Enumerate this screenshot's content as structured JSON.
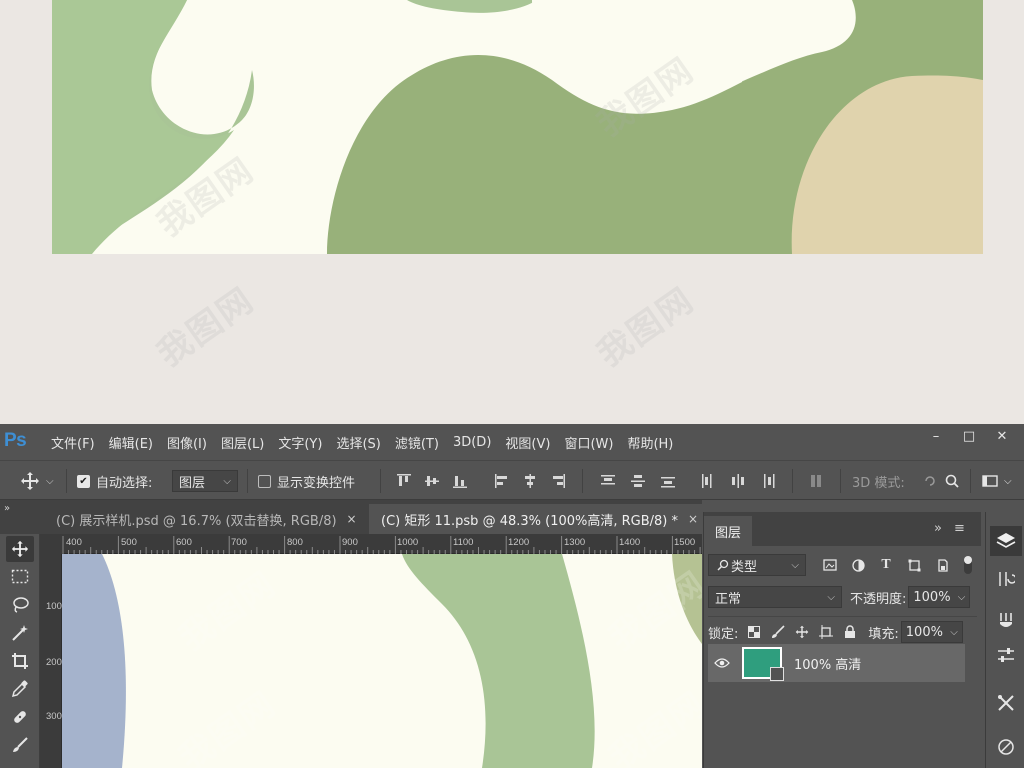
{
  "photoshop": {
    "logo": "Ps",
    "menu": [
      "文件(F)",
      "编辑(E)",
      "图像(I)",
      "图层(L)",
      "文字(Y)",
      "选择(S)",
      "滤镜(T)",
      "3D(D)",
      "视图(V)",
      "窗口(W)",
      "帮助(H)"
    ],
    "window_controls": [
      "–",
      "□",
      "✕"
    ]
  },
  "options_bar": {
    "auto_select_label": "自动选择:",
    "auto_select_checked": true,
    "auto_select_target": "图层",
    "show_transform_label": "显示变换控件",
    "show_transform_checked": false,
    "mode_3d_label": "3D 模式:"
  },
  "documents": {
    "tabs": [
      {
        "title": "(C) 展示样机.psd @ 16.7% (双击替换, RGB/8)",
        "close": "×",
        "active": false
      },
      {
        "title": "(C) 矩形 11.psb @ 48.3% (100%高清, RGB/8) *",
        "close": "×",
        "active": true
      }
    ]
  },
  "rulers": {
    "horizontal": [
      "400",
      "500",
      "600",
      "700",
      "800",
      "900",
      "1000",
      "1100",
      "1200",
      "1300",
      "1400",
      "1500"
    ],
    "vertical": [
      "100",
      "200",
      "300"
    ]
  },
  "layers_panel": {
    "title": "图层",
    "filter_kind": "类型",
    "blend_mode": "正常",
    "opacity_label": "不透明度:",
    "opacity_value": "100%",
    "lock_label": "锁定:",
    "fill_label": "填充:",
    "fill_value": "100%",
    "layers": [
      {
        "name": "100% 高清",
        "visible": true,
        "thumb_color": "#2f9e7e"
      }
    ]
  },
  "colors": {
    "artwork_cream": "#fcfcf1",
    "artwork_green": "#a9c596",
    "artwork_olive": "#98b17a",
    "artwork_tan": "#e0d3ad",
    "artwork_blue": "#a5b3cc",
    "page_bg": "#ebe7e3"
  }
}
